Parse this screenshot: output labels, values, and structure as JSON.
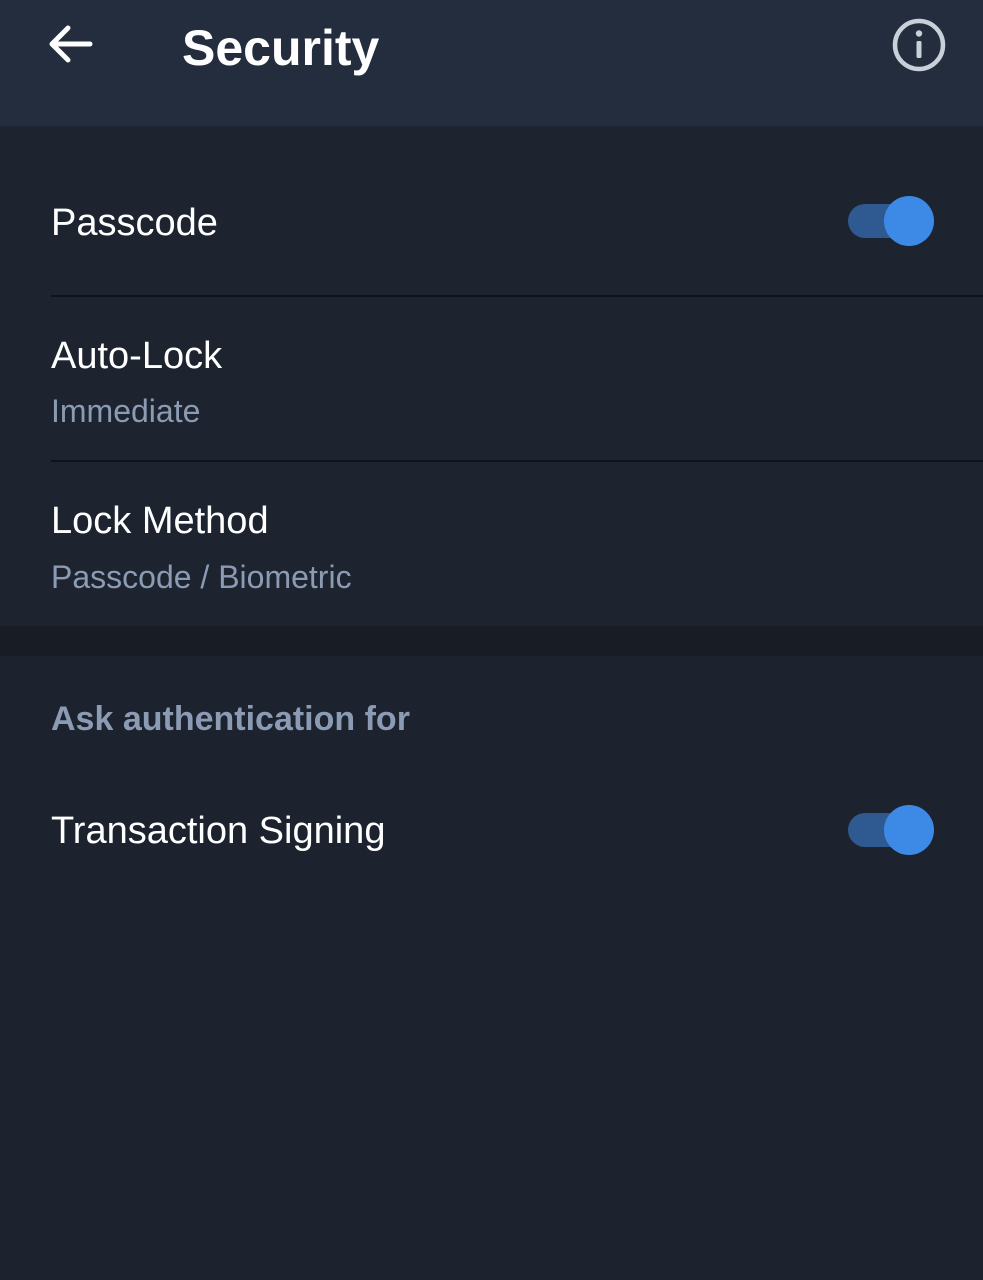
{
  "header": {
    "title": "Security",
    "back_icon": "arrow-left-icon",
    "info_icon": "info-circle-icon"
  },
  "security": {
    "passcode": {
      "label": "Passcode",
      "enabled": true
    },
    "auto_lock": {
      "label": "Auto-Lock",
      "value": "Immediate"
    },
    "lock_method": {
      "label": "Lock Method",
      "value": "Passcode / Biometric"
    }
  },
  "ask_auth": {
    "section_title": "Ask authentication for",
    "transaction_signing": {
      "label": "Transaction Signing",
      "enabled": true
    }
  },
  "colors": {
    "background": "#1c222e",
    "header": "#232d3d",
    "accent": "#3d8ae6",
    "toggle_track": "#2f5a91",
    "secondary_text": "#8a9bb3"
  }
}
